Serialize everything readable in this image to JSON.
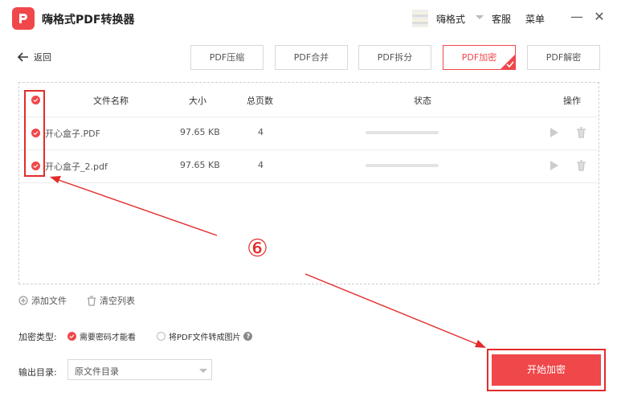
{
  "app": {
    "title": "嗨格式PDF转换器"
  },
  "titlebar": {
    "user_name": "嗨格式",
    "service": "客服",
    "menu": "菜单",
    "minimize": "—",
    "close": "✕"
  },
  "toolbar": {
    "back_label": "返回",
    "tabs": [
      {
        "label": "PDF压缩"
      },
      {
        "label": "PDF合并"
      },
      {
        "label": "PDF拆分"
      },
      {
        "label": "PDF加密",
        "active": true
      },
      {
        "label": "PDF解密"
      }
    ]
  },
  "table": {
    "headers": {
      "name": "文件名称",
      "size": "大小",
      "pages": "总页数",
      "status": "状态",
      "ops": "操作"
    },
    "rows": [
      {
        "name": "开心盒子.PDF",
        "size": "97.65 KB",
        "pages": "4",
        "progress": 0
      },
      {
        "name": "开心盒子_2.pdf",
        "size": "97.65 KB",
        "pages": "4",
        "progress": 0
      }
    ]
  },
  "actions": {
    "add_file": "添加文件",
    "clear_list": "清空列表"
  },
  "encrypt": {
    "type_label": "加密类型:",
    "option_password": "需要密码才能看",
    "option_image": "将PDF文件转成图片",
    "help": "?"
  },
  "output": {
    "label": "输出目录:",
    "value": "原文件目录"
  },
  "start_button": "开始加密",
  "annotation": {
    "step": "⑥"
  },
  "colors": {
    "accent": "#f0474a",
    "annotation": "#e32b2b"
  }
}
